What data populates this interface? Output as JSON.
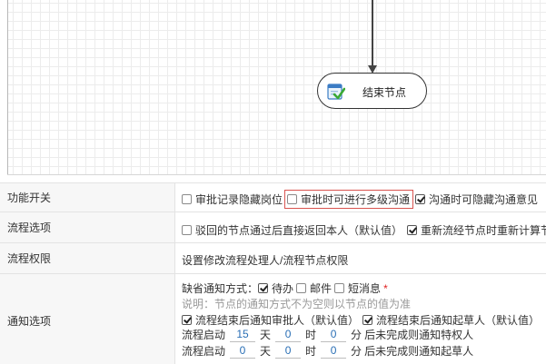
{
  "diagram": {
    "end_node_label": "结束节点",
    "end_node_icon": "check-document-icon"
  },
  "settings": {
    "feature_switch": {
      "label": "功能开关",
      "options": [
        {
          "label": "审批记录隐藏岗位",
          "checked": false
        },
        {
          "label": "审批时可进行多级沟通",
          "checked": false
        },
        {
          "label": "沟通时可隐藏沟通意见",
          "checked": true
        }
      ]
    },
    "flow_options": {
      "label": "流程选项",
      "options": [
        {
          "label": "驳回的节点通过后直接返回本人（默认值）",
          "checked": false
        },
        {
          "label": "重新流经节点时重新计算节",
          "checked": true
        }
      ]
    },
    "flow_permission": {
      "label": "流程权限",
      "link": "设置修改流程处理人/流程节点权限"
    },
    "notify_options": {
      "label": "通知选项",
      "default_method_label": "缺省通知方式：",
      "methods": [
        {
          "label": "待办",
          "checked": true
        },
        {
          "label": "邮件",
          "checked": false
        },
        {
          "label": "短消息",
          "checked": false
        }
      ],
      "required_mark": "*",
      "note": "说明：节点的通知方式不为空则以节点的值为准",
      "after_end": [
        {
          "label": "流程结束后通知审批人（默认值）",
          "checked": true
        },
        {
          "label": "流程结束后通知起草人（默认值）",
          "checked": true
        }
      ],
      "reminder1": {
        "prefix": "流程启动",
        "days": "15",
        "days_unit": "天",
        "hours": "0",
        "hours_unit": "时",
        "minutes": "0",
        "minutes_unit": "分",
        "suffix": "后未完成则通知特权人"
      },
      "reminder2": {
        "prefix": "流程启动",
        "days": "0",
        "days_unit": "天",
        "hours": "0",
        "hours_unit": "时",
        "minutes": "0",
        "minutes_unit": "分",
        "suffix": "后未完成则通知起草人"
      }
    }
  }
}
